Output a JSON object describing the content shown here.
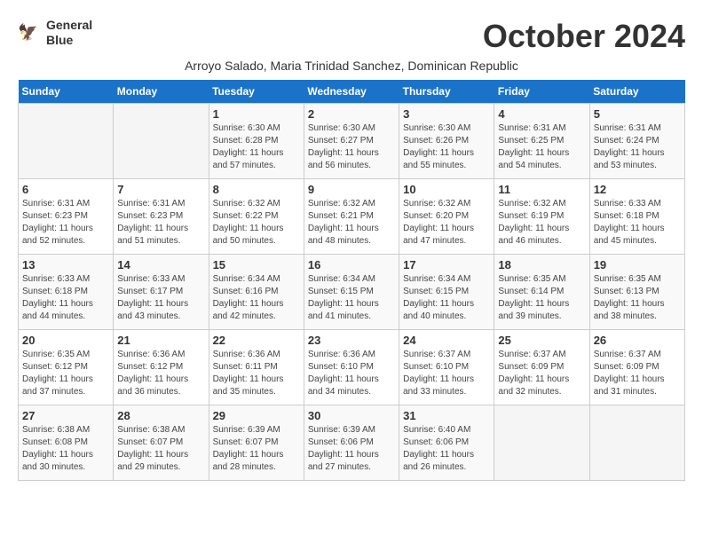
{
  "header": {
    "logo_line1": "General",
    "logo_line2": "Blue",
    "month": "October 2024",
    "subtitle": "Arroyo Salado, Maria Trinidad Sanchez, Dominican Republic"
  },
  "weekdays": [
    "Sunday",
    "Monday",
    "Tuesday",
    "Wednesday",
    "Thursday",
    "Friday",
    "Saturday"
  ],
  "weeks": [
    [
      {
        "day": "",
        "info": ""
      },
      {
        "day": "",
        "info": ""
      },
      {
        "day": "1",
        "info": "Sunrise: 6:30 AM\nSunset: 6:28 PM\nDaylight: 11 hours and 57 minutes."
      },
      {
        "day": "2",
        "info": "Sunrise: 6:30 AM\nSunset: 6:27 PM\nDaylight: 11 hours and 56 minutes."
      },
      {
        "day": "3",
        "info": "Sunrise: 6:30 AM\nSunset: 6:26 PM\nDaylight: 11 hours and 55 minutes."
      },
      {
        "day": "4",
        "info": "Sunrise: 6:31 AM\nSunset: 6:25 PM\nDaylight: 11 hours and 54 minutes."
      },
      {
        "day": "5",
        "info": "Sunrise: 6:31 AM\nSunset: 6:24 PM\nDaylight: 11 hours and 53 minutes."
      }
    ],
    [
      {
        "day": "6",
        "info": "Sunrise: 6:31 AM\nSunset: 6:23 PM\nDaylight: 11 hours and 52 minutes."
      },
      {
        "day": "7",
        "info": "Sunrise: 6:31 AM\nSunset: 6:23 PM\nDaylight: 11 hours and 51 minutes."
      },
      {
        "day": "8",
        "info": "Sunrise: 6:32 AM\nSunset: 6:22 PM\nDaylight: 11 hours and 50 minutes."
      },
      {
        "day": "9",
        "info": "Sunrise: 6:32 AM\nSunset: 6:21 PM\nDaylight: 11 hours and 48 minutes."
      },
      {
        "day": "10",
        "info": "Sunrise: 6:32 AM\nSunset: 6:20 PM\nDaylight: 11 hours and 47 minutes."
      },
      {
        "day": "11",
        "info": "Sunrise: 6:32 AM\nSunset: 6:19 PM\nDaylight: 11 hours and 46 minutes."
      },
      {
        "day": "12",
        "info": "Sunrise: 6:33 AM\nSunset: 6:18 PM\nDaylight: 11 hours and 45 minutes."
      }
    ],
    [
      {
        "day": "13",
        "info": "Sunrise: 6:33 AM\nSunset: 6:18 PM\nDaylight: 11 hours and 44 minutes."
      },
      {
        "day": "14",
        "info": "Sunrise: 6:33 AM\nSunset: 6:17 PM\nDaylight: 11 hours and 43 minutes."
      },
      {
        "day": "15",
        "info": "Sunrise: 6:34 AM\nSunset: 6:16 PM\nDaylight: 11 hours and 42 minutes."
      },
      {
        "day": "16",
        "info": "Sunrise: 6:34 AM\nSunset: 6:15 PM\nDaylight: 11 hours and 41 minutes."
      },
      {
        "day": "17",
        "info": "Sunrise: 6:34 AM\nSunset: 6:15 PM\nDaylight: 11 hours and 40 minutes."
      },
      {
        "day": "18",
        "info": "Sunrise: 6:35 AM\nSunset: 6:14 PM\nDaylight: 11 hours and 39 minutes."
      },
      {
        "day": "19",
        "info": "Sunrise: 6:35 AM\nSunset: 6:13 PM\nDaylight: 11 hours and 38 minutes."
      }
    ],
    [
      {
        "day": "20",
        "info": "Sunrise: 6:35 AM\nSunset: 6:12 PM\nDaylight: 11 hours and 37 minutes."
      },
      {
        "day": "21",
        "info": "Sunrise: 6:36 AM\nSunset: 6:12 PM\nDaylight: 11 hours and 36 minutes."
      },
      {
        "day": "22",
        "info": "Sunrise: 6:36 AM\nSunset: 6:11 PM\nDaylight: 11 hours and 35 minutes."
      },
      {
        "day": "23",
        "info": "Sunrise: 6:36 AM\nSunset: 6:10 PM\nDaylight: 11 hours and 34 minutes."
      },
      {
        "day": "24",
        "info": "Sunrise: 6:37 AM\nSunset: 6:10 PM\nDaylight: 11 hours and 33 minutes."
      },
      {
        "day": "25",
        "info": "Sunrise: 6:37 AM\nSunset: 6:09 PM\nDaylight: 11 hours and 32 minutes."
      },
      {
        "day": "26",
        "info": "Sunrise: 6:37 AM\nSunset: 6:09 PM\nDaylight: 11 hours and 31 minutes."
      }
    ],
    [
      {
        "day": "27",
        "info": "Sunrise: 6:38 AM\nSunset: 6:08 PM\nDaylight: 11 hours and 30 minutes."
      },
      {
        "day": "28",
        "info": "Sunrise: 6:38 AM\nSunset: 6:07 PM\nDaylight: 11 hours and 29 minutes."
      },
      {
        "day": "29",
        "info": "Sunrise: 6:39 AM\nSunset: 6:07 PM\nDaylight: 11 hours and 28 minutes."
      },
      {
        "day": "30",
        "info": "Sunrise: 6:39 AM\nSunset: 6:06 PM\nDaylight: 11 hours and 27 minutes."
      },
      {
        "day": "31",
        "info": "Sunrise: 6:40 AM\nSunset: 6:06 PM\nDaylight: 11 hours and 26 minutes."
      },
      {
        "day": "",
        "info": ""
      },
      {
        "day": "",
        "info": ""
      }
    ]
  ]
}
